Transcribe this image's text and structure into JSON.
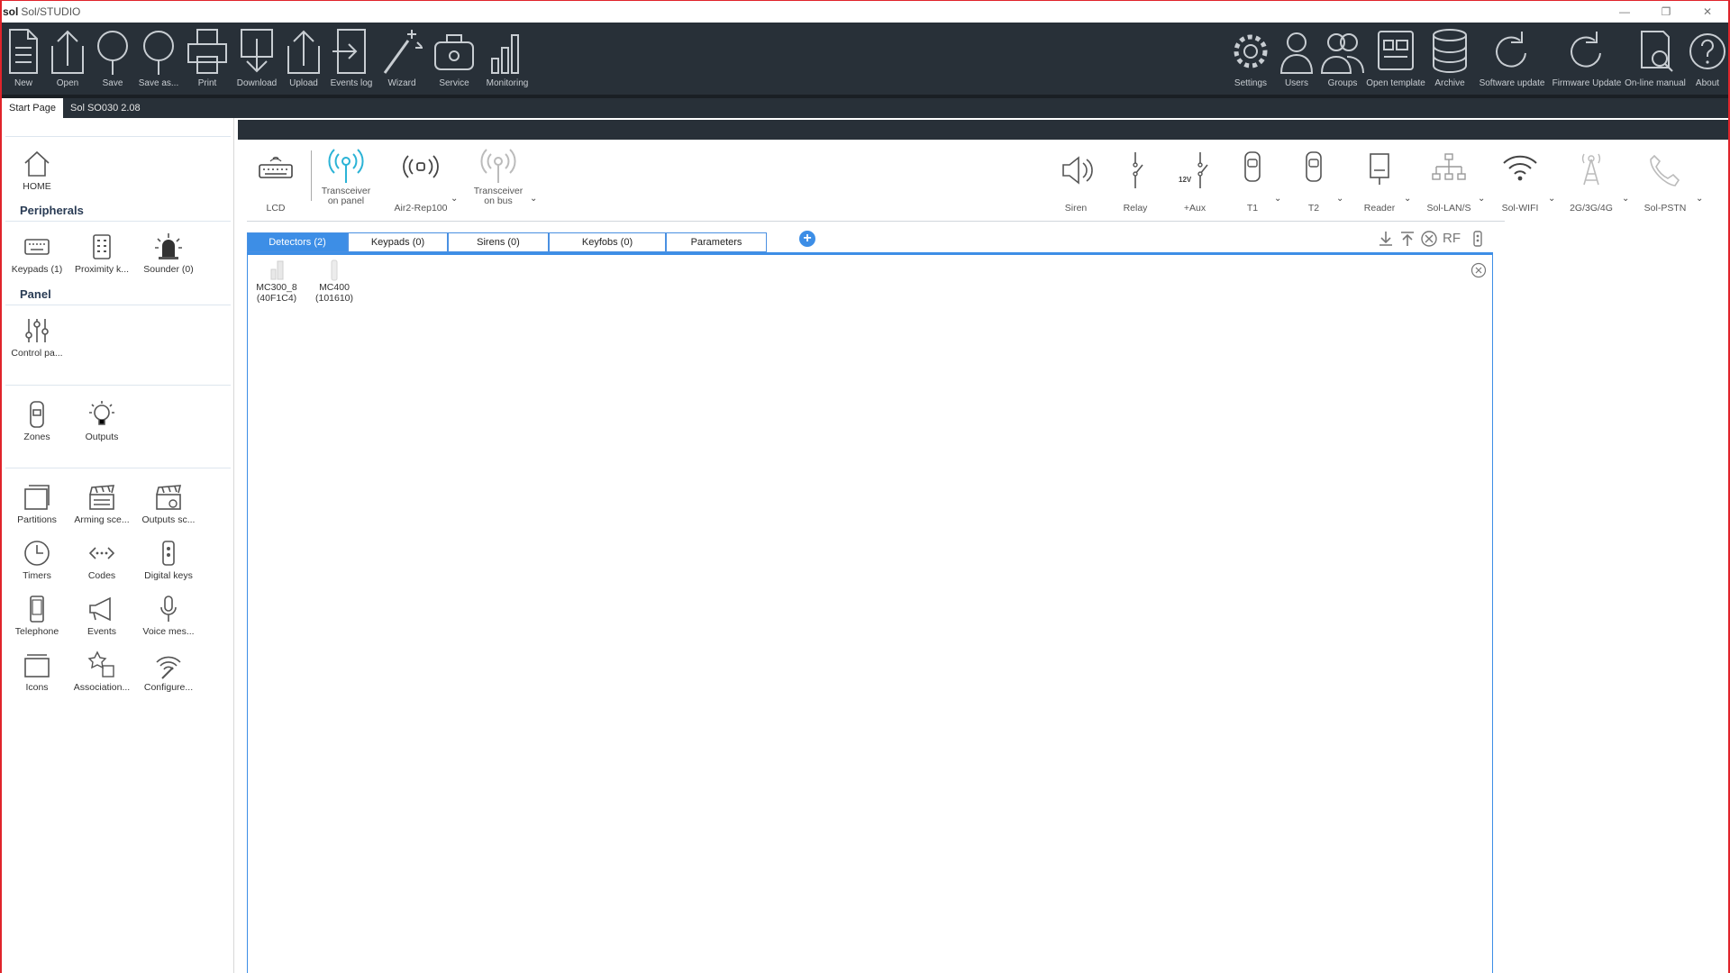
{
  "window": {
    "logo": "sol",
    "title": "Sol/STUDIO",
    "minimize": "—",
    "restore": "❐",
    "close": "✕"
  },
  "toolbar_left": [
    {
      "label": "New",
      "icon": "new-document-icon"
    },
    {
      "label": "Open",
      "icon": "open-upload-icon"
    },
    {
      "label": "Save",
      "icon": "save-pin-icon"
    },
    {
      "label": "Save as...",
      "icon": "save-as-pin-icon"
    },
    {
      "label": "Print",
      "icon": "print-icon"
    },
    {
      "label": "Download",
      "icon": "download-icon"
    },
    {
      "label": "Upload",
      "icon": "upload-icon"
    },
    {
      "label": "Events log",
      "icon": "events-log-icon"
    },
    {
      "label": "Wizard",
      "icon": "wizard-icon"
    },
    {
      "label": "Service",
      "icon": "service-icon"
    },
    {
      "label": "Monitoring",
      "icon": "monitoring-icon"
    }
  ],
  "toolbar_right": [
    {
      "label": "Settings",
      "icon": "settings-gear-icon"
    },
    {
      "label": "Users",
      "icon": "user-icon"
    },
    {
      "label": "Groups",
      "icon": "groups-icon"
    },
    {
      "label": "Open template",
      "icon": "template-icon"
    },
    {
      "label": "Archive",
      "icon": "archive-database-icon"
    },
    {
      "label": "Software update",
      "icon": "software-update-icon"
    },
    {
      "label": "Firmware Update",
      "icon": "firmware-update-icon"
    },
    {
      "label": "On-line manual",
      "icon": "manual-icon"
    },
    {
      "label": "About",
      "icon": "help-icon"
    }
  ],
  "doc_tabs": {
    "start": "Start Page",
    "active": "Sol SO030 2.08"
  },
  "sidebar": {
    "home": "HOME",
    "peripherals_heading": "Peripherals",
    "keypads": "Keypads (1)",
    "proximity": "Proximity k...",
    "sounder": "Sounder (0)",
    "panel_heading": "Panel",
    "control_panel": "Control pa...",
    "zones": "Zones",
    "outputs": "Outputs",
    "partitions": "Partitions",
    "arming": "Arming sce...",
    "outputs_sc": "Outputs sc...",
    "timers": "Timers",
    "codes": "Codes",
    "digital_keys": "Digital keys",
    "telephone": "Telephone",
    "events": "Events",
    "voice": "Voice mes...",
    "icons": "Icons",
    "association": "Association...",
    "configure": "Configure..."
  },
  "devices_left": {
    "lcd": "LCD",
    "transceiver_panel_1": "Transceiver",
    "transceiver_panel_2": "on panel",
    "air2": "Air2-Rep100",
    "transceiver_bus_1": "Transceiver",
    "transceiver_bus_2": "on bus"
  },
  "devices_right": {
    "siren": "Siren",
    "relay": "Relay",
    "aux": "+Aux",
    "aux_badge": "12V",
    "t1": "T1",
    "t2": "T2",
    "reader": "Reader",
    "lan": "Sol-LAN/S",
    "wifi": "Sol-WIFI",
    "cell": "2G/3G/4G",
    "pstn": "Sol-PSTN"
  },
  "chevron": "⌄",
  "subtabs": {
    "detectors": "Detectors (2)",
    "keypads": "Keypads (0)",
    "sirens": "Sirens (0)",
    "keyfobs": "Keyfobs (0)",
    "parameters": "Parameters",
    "add": "+"
  },
  "actions": {
    "rf": "RF"
  },
  "detectors": [
    {
      "name": "MC300_8",
      "id": "(40F1C4)"
    },
    {
      "name": "MC400",
      "id": "(101610)"
    }
  ],
  "colors": {
    "toolbar_bg": "#283038",
    "accent_blue": "#3d8ee6",
    "frame_red": "#e0242b",
    "active_icon": "#2bb3d6"
  }
}
